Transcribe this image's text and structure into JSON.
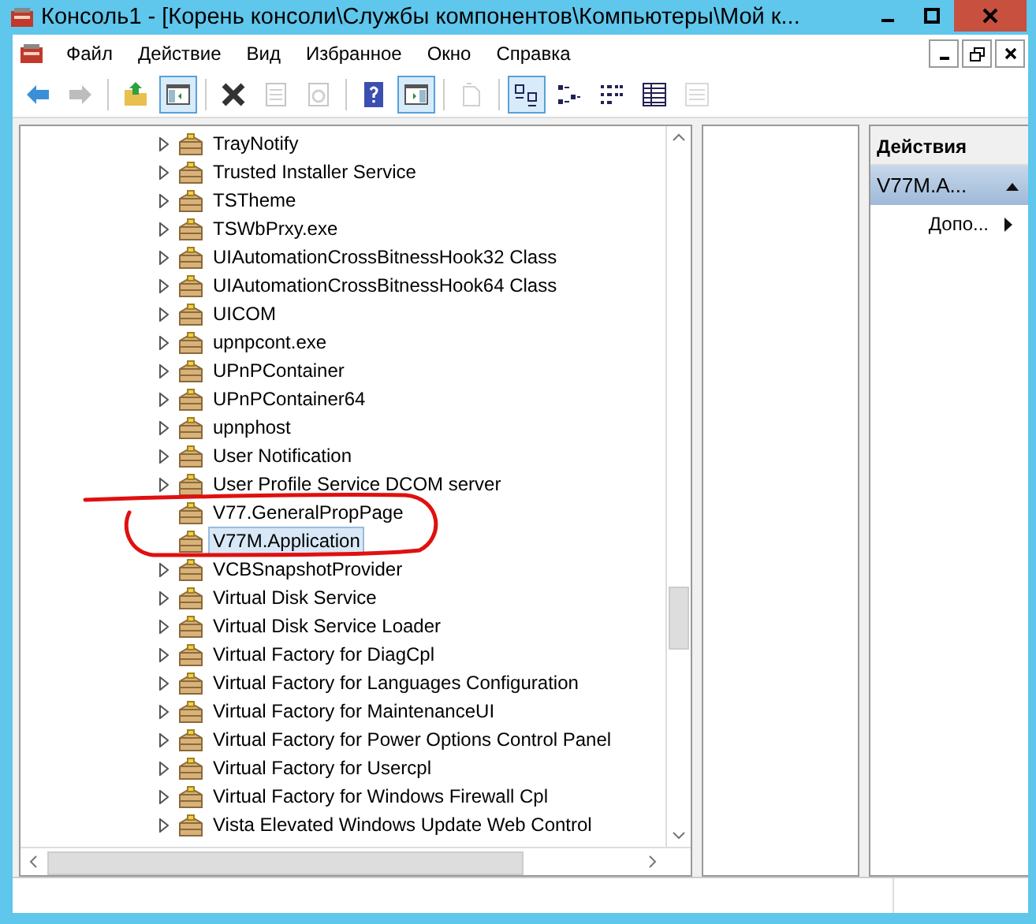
{
  "window": {
    "title": "Консоль1 - [Корень консоли\\Службы компонентов\\Компьютеры\\Мой к..."
  },
  "menu": [
    "Файл",
    "Действие",
    "Вид",
    "Избранное",
    "Окно",
    "Справка"
  ],
  "toolbar": [
    {
      "kind": "back",
      "pressed": false,
      "disabled": false
    },
    {
      "kind": "forward",
      "pressed": false,
      "disabled": true
    },
    {
      "kind": "sep"
    },
    {
      "kind": "up",
      "pressed": false,
      "disabled": false
    },
    {
      "kind": "tree",
      "pressed": true,
      "disabled": false
    },
    {
      "kind": "sep"
    },
    {
      "kind": "delete",
      "pressed": false,
      "disabled": false
    },
    {
      "kind": "properties",
      "pressed": false,
      "disabled": true
    },
    {
      "kind": "refresh",
      "pressed": false,
      "disabled": true
    },
    {
      "kind": "sep"
    },
    {
      "kind": "help",
      "pressed": false,
      "disabled": false
    },
    {
      "kind": "actionpane",
      "pressed": true,
      "disabled": false
    },
    {
      "kind": "sep"
    },
    {
      "kind": "export",
      "pressed": false,
      "disabled": true
    },
    {
      "kind": "sep"
    },
    {
      "kind": "largeicons",
      "pressed": true,
      "disabled": false
    },
    {
      "kind": "smallicons",
      "pressed": false,
      "disabled": false
    },
    {
      "kind": "list",
      "pressed": false,
      "disabled": false
    },
    {
      "kind": "details",
      "pressed": false,
      "disabled": false
    },
    {
      "kind": "filter",
      "pressed": false,
      "disabled": true
    }
  ],
  "tree": {
    "items": [
      {
        "label": "TrayNotify",
        "expandable": true,
        "selected": false
      },
      {
        "label": "Trusted Installer Service",
        "expandable": true,
        "selected": false
      },
      {
        "label": "TSTheme",
        "expandable": true,
        "selected": false
      },
      {
        "label": "TSWbPrxy.exe",
        "expandable": true,
        "selected": false
      },
      {
        "label": "UIAutomationCrossBitnessHook32 Class",
        "expandable": true,
        "selected": false
      },
      {
        "label": "UIAutomationCrossBitnessHook64 Class",
        "expandable": true,
        "selected": false
      },
      {
        "label": "UICOM",
        "expandable": true,
        "selected": false
      },
      {
        "label": "upnpcont.exe",
        "expandable": true,
        "selected": false
      },
      {
        "label": "UPnPContainer",
        "expandable": true,
        "selected": false
      },
      {
        "label": "UPnPContainer64",
        "expandable": true,
        "selected": false
      },
      {
        "label": "upnphost",
        "expandable": true,
        "selected": false
      },
      {
        "label": "User Notification",
        "expandable": true,
        "selected": false
      },
      {
        "label": "User Profile Service DCOM server",
        "expandable": true,
        "selected": false
      },
      {
        "label": "V77.GeneralPropPage",
        "expandable": false,
        "selected": false
      },
      {
        "label": "V77M.Application",
        "expandable": false,
        "selected": true
      },
      {
        "label": "VCBSnapshotProvider",
        "expandable": true,
        "selected": false
      },
      {
        "label": "Virtual Disk Service",
        "expandable": true,
        "selected": false
      },
      {
        "label": "Virtual Disk Service Loader",
        "expandable": true,
        "selected": false
      },
      {
        "label": "Virtual Factory for DiagCpl",
        "expandable": true,
        "selected": false
      },
      {
        "label": "Virtual Factory for Languages Configuration",
        "expandable": true,
        "selected": false
      },
      {
        "label": "Virtual Factory for MaintenanceUI",
        "expandable": true,
        "selected": false
      },
      {
        "label": "Virtual Factory for Power Options Control Panel",
        "expandable": true,
        "selected": false
      },
      {
        "label": "Virtual Factory for Usercpl",
        "expandable": true,
        "selected": false
      },
      {
        "label": "Virtual Factory for Windows Firewall Cpl",
        "expandable": true,
        "selected": false
      },
      {
        "label": "Vista Elevated Windows Update Web Control",
        "expandable": true,
        "selected": false
      }
    ]
  },
  "actions": {
    "header": "Действия",
    "items": [
      {
        "label": "V77M.A...",
        "kind": "group"
      },
      {
        "label": "Допо...",
        "kind": "submenu"
      }
    ]
  }
}
